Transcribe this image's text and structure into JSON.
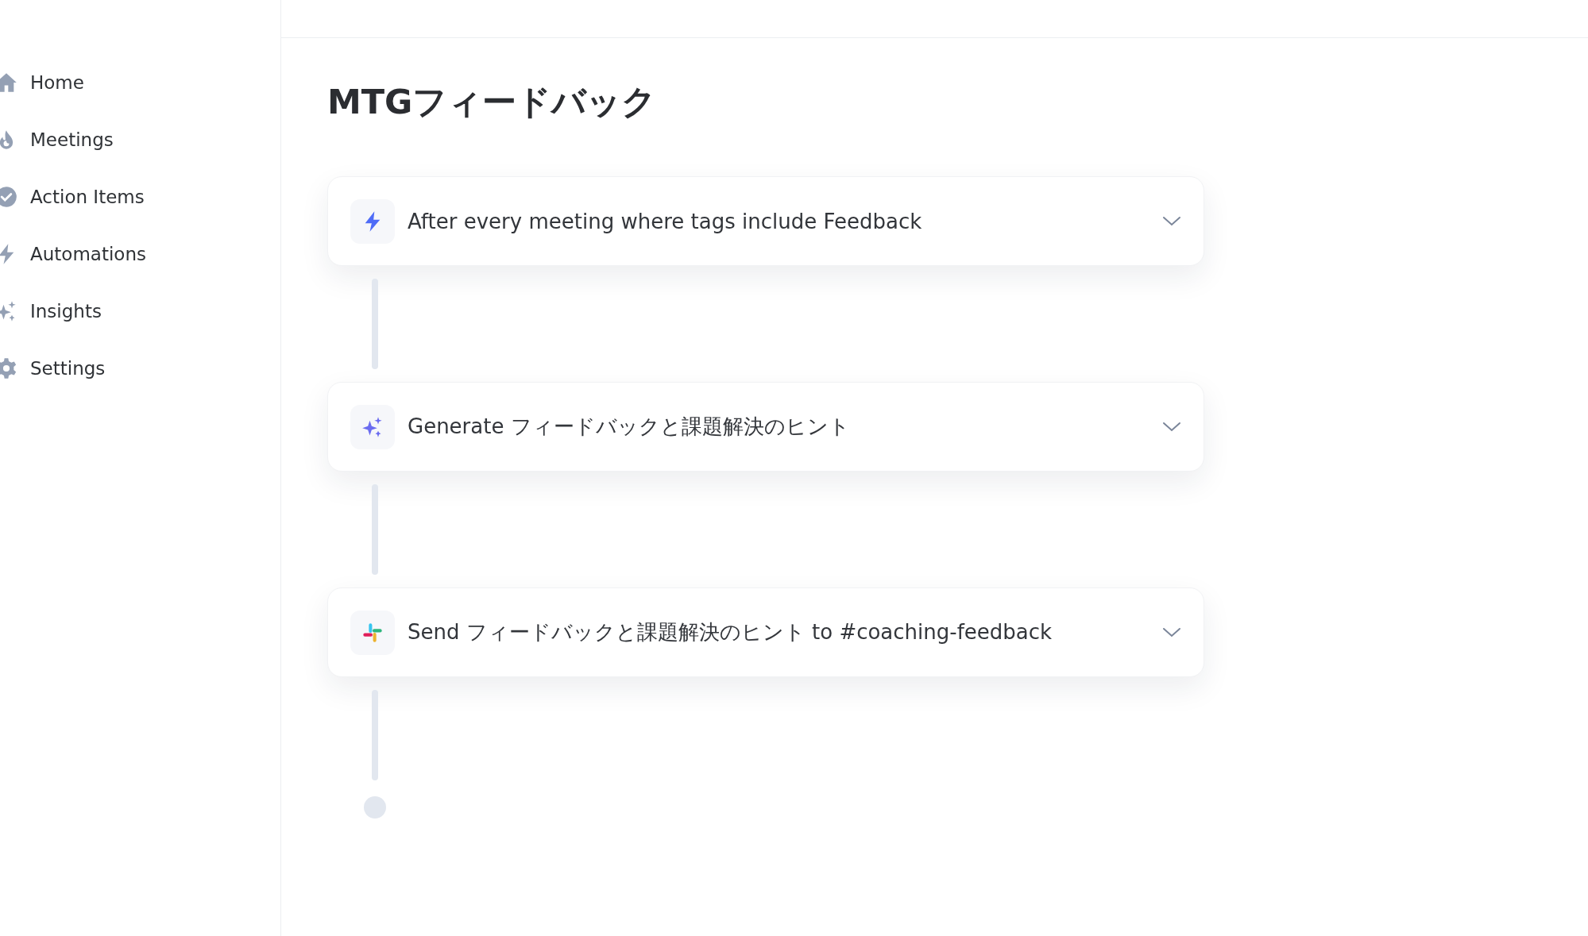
{
  "sidebar": {
    "items": [
      {
        "label": "Home",
        "kind": "home"
      },
      {
        "label": "Meetings",
        "kind": "meetings"
      },
      {
        "label": "Action Items",
        "kind": "actions"
      },
      {
        "label": "Automations",
        "kind": "automations"
      },
      {
        "label": "Insights",
        "kind": "insights"
      },
      {
        "label": "Settings",
        "kind": "settings"
      }
    ]
  },
  "page": {
    "title": "MTGフィードバック",
    "steps": [
      {
        "kind": "trigger",
        "text": "After every meeting where tags include Feedback"
      },
      {
        "kind": "ai",
        "text": "Generate フィードバックと課題解決のヒント"
      },
      {
        "kind": "slack",
        "text": "Send フィードバックと課題解決のヒント to #coaching-feedback"
      }
    ]
  }
}
